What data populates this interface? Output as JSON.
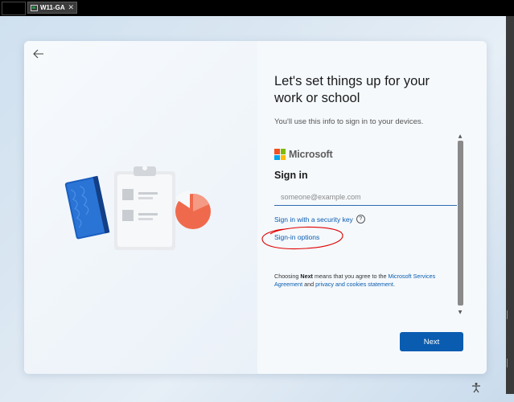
{
  "vm_tab": {
    "label": "W11-GA",
    "close": "✕"
  },
  "setup": {
    "title": "Let's set things up for your work or school",
    "subtitle": "You'll use this info to sign in to your devices."
  },
  "signin": {
    "brand": "Microsoft",
    "heading": "Sign in",
    "email_placeholder": "someone@example.com",
    "email_value": "",
    "security_key_link": "Sign in with a security key",
    "help_glyph": "?",
    "options_link": "Sign-in options"
  },
  "terms": {
    "prefix": "Choosing ",
    "next_word": "Next",
    "middle": " means that you agree to the ",
    "services_agreement": "Microsoft Services Agreement",
    "and": " and ",
    "privacy": "privacy and cookies statement",
    "suffix": "."
  },
  "scroll": {
    "up": "▲",
    "down": "▼"
  },
  "buttons": {
    "next": "Next",
    "back_icon": "arrow-left"
  },
  "colors": {
    "accent": "#0a5cb0",
    "ms_red": "#f25022",
    "ms_green": "#7fba00",
    "ms_blue": "#00a4ef",
    "ms_yellow": "#ffb900",
    "annotation": "#e00000"
  }
}
